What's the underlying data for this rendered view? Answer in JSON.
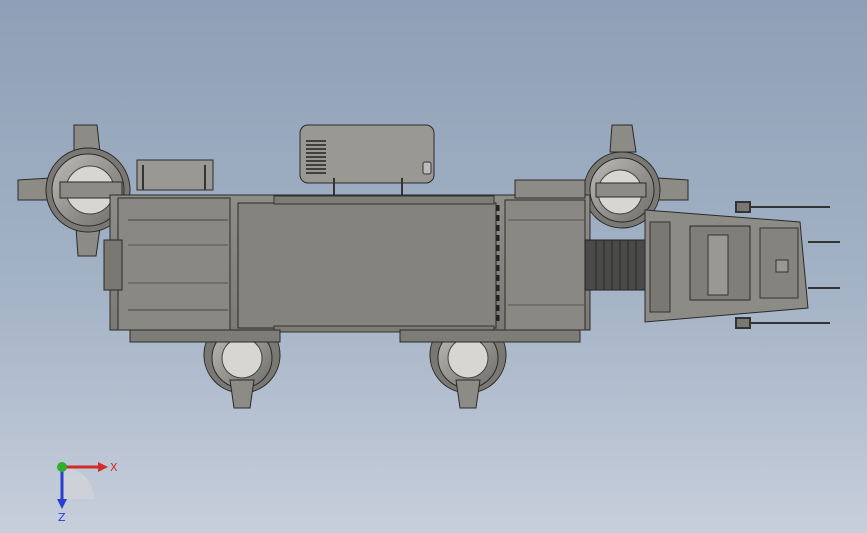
{
  "viewport": {
    "background_top": "#8ea0b7",
    "background_bottom": "#c7cfdb"
  },
  "model": {
    "body_color": "#8c8a85",
    "body_dark": "#6e6c68",
    "body_light": "#a09e99",
    "edge_color": "#2a2a2a"
  },
  "triad": {
    "x_label": "X",
    "z_label": "Z",
    "x_color": "#d12b2b",
    "y_color": "#2fae2f",
    "z_color": "#2a3fd1"
  }
}
